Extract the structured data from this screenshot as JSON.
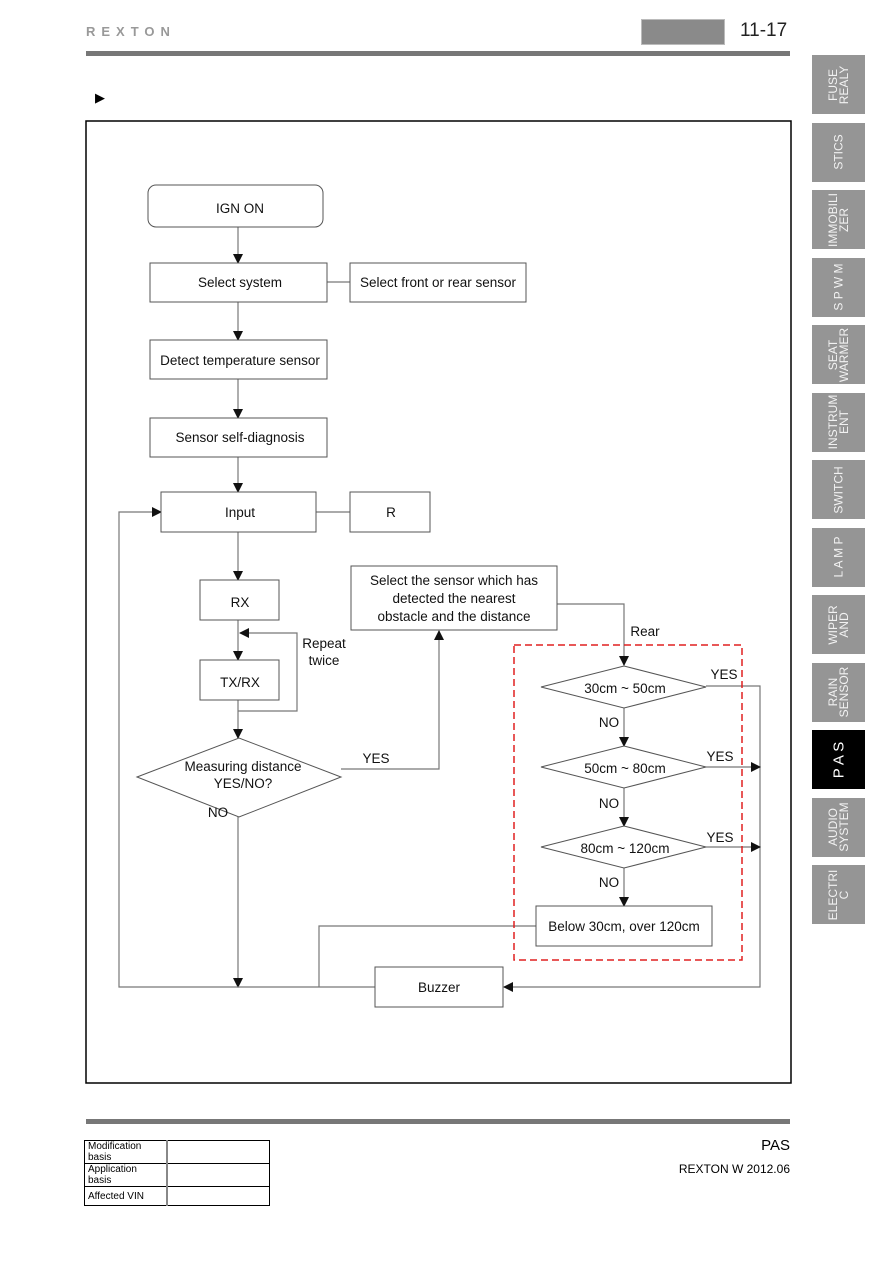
{
  "header": {
    "brand": "REXTON",
    "page_number": "11-17"
  },
  "side_tabs": [
    {
      "label": "FUSE\nREALY",
      "active": false
    },
    {
      "label": "STICS",
      "active": false
    },
    {
      "label": "IMMOBILI\nZER",
      "active": false
    },
    {
      "label": "S P W M",
      "active": false
    },
    {
      "label": "SEAT\nWARMER",
      "active": false
    },
    {
      "label": "INSTRUM\nENT",
      "active": false
    },
    {
      "label": "SWITCH",
      "active": false
    },
    {
      "label": "L A M P",
      "active": false
    },
    {
      "label": "WIPER\nAND",
      "active": false
    },
    {
      "label": "RAIN\nSENSOR",
      "active": false
    },
    {
      "label": "P A S",
      "active": true
    },
    {
      "label": "AUDIO\nSYSTEM",
      "active": false
    },
    {
      "label": "ELECTRI\nC",
      "active": false
    }
  ],
  "bullet": "▶",
  "flowchart": {
    "ign_on": "IGN ON",
    "select_system": "Select system",
    "select_front_rear": "Select front or rear sensor",
    "detect_temp": "Detect temperature sensor",
    "self_diag": "Sensor self-diagnosis",
    "input": "Input",
    "r": "R",
    "rx": "RX",
    "txrx": "TX/RX",
    "repeat1": "Repeat",
    "repeat2": "twice",
    "measuring1": "Measuring distance",
    "measuring2": "YES/NO?",
    "yes": "YES",
    "no": "NO",
    "select_sensor1": "Select the sensor which has",
    "select_sensor2": "detected the nearest",
    "select_sensor3": "obstacle and the distance",
    "rear": "Rear",
    "d1": "30cm ~ 50cm",
    "d2": "50cm ~ 80cm",
    "d3": "80cm ~ 120cm",
    "out_range": "Below 30cm, over 120cm",
    "buzzer": "Buzzer",
    "highlight_color": "#e02020"
  },
  "footer": {
    "meta": [
      {
        "label": "Modification basis",
        "value": ""
      },
      {
        "label": "Application basis",
        "value": ""
      },
      {
        "label": "Affected VIN",
        "value": ""
      }
    ],
    "section": "PAS",
    "model": "REXTON W 2012.06"
  }
}
